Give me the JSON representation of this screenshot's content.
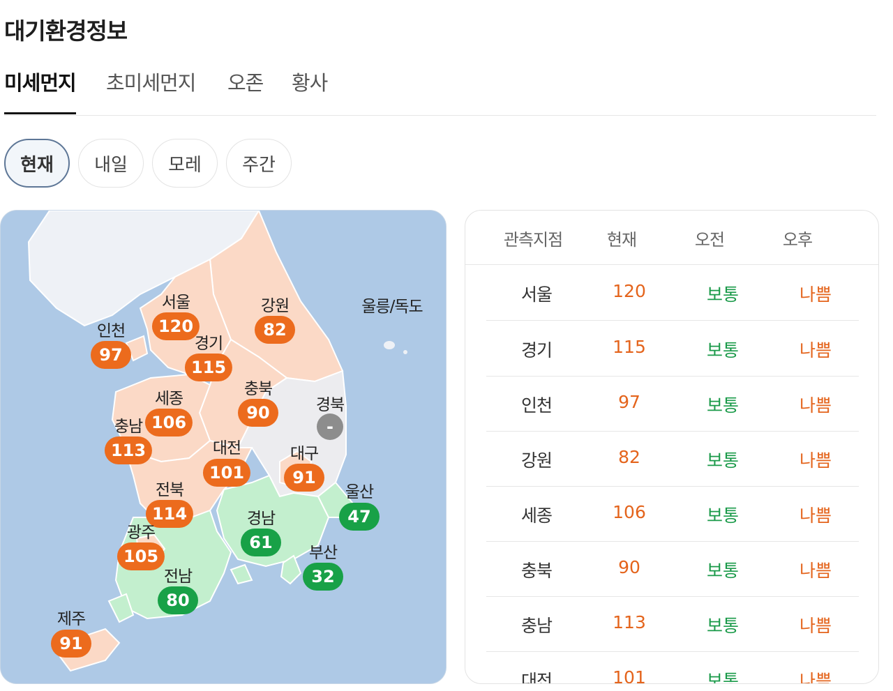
{
  "title": "대기환경정보",
  "tabs": [
    {
      "label": "미세먼지",
      "active": true
    },
    {
      "label": "초미세먼지",
      "active": false
    },
    {
      "label": "오존",
      "active": false
    },
    {
      "label": "황사",
      "active": false
    }
  ],
  "periods": [
    {
      "label": "현재",
      "active": true
    },
    {
      "label": "내일",
      "active": false
    },
    {
      "label": "모레",
      "active": false
    },
    {
      "label": "주간",
      "active": false
    }
  ],
  "colors": {
    "bad": "#ec6b1d",
    "normal": "#18a147",
    "no_data": "#8d8d8d",
    "sea": "#aec9e6",
    "bad_area": "#fbd9c6",
    "normal_area": "#c3efce",
    "no_data_area": "#ececef"
  },
  "map": {
    "regions": [
      {
        "name": "서울",
        "value": "120",
        "level": "bad"
      },
      {
        "name": "인천",
        "value": "97",
        "level": "bad"
      },
      {
        "name": "강원",
        "value": "82",
        "level": "bad"
      },
      {
        "name": "경기",
        "value": "115",
        "level": "bad"
      },
      {
        "name": "충북",
        "value": "90",
        "level": "bad"
      },
      {
        "name": "세종",
        "value": "106",
        "level": "bad"
      },
      {
        "name": "충남",
        "value": "113",
        "level": "bad"
      },
      {
        "name": "경북",
        "value": "-",
        "level": "none"
      },
      {
        "name": "대전",
        "value": "101",
        "level": "bad"
      },
      {
        "name": "대구",
        "value": "91",
        "level": "bad"
      },
      {
        "name": "울산",
        "value": "47",
        "level": "normal"
      },
      {
        "name": "전북",
        "value": "114",
        "level": "bad"
      },
      {
        "name": "경남",
        "value": "61",
        "level": "normal"
      },
      {
        "name": "광주",
        "value": "105",
        "level": "bad"
      },
      {
        "name": "부산",
        "value": "32",
        "level": "normal"
      },
      {
        "name": "전남",
        "value": "80",
        "level": "normal"
      },
      {
        "name": "제주",
        "value": "91",
        "level": "bad"
      },
      {
        "name": "울릉/독도",
        "value": "",
        "level": "none"
      }
    ]
  },
  "table": {
    "headers": [
      "관측지점",
      "현재",
      "오전",
      "오후"
    ],
    "rows": [
      {
        "name": "서울",
        "now": "120",
        "am": "보통",
        "pm": "나쁨"
      },
      {
        "name": "경기",
        "now": "115",
        "am": "보통",
        "pm": "나쁨"
      },
      {
        "name": "인천",
        "now": "97",
        "am": "보통",
        "pm": "나쁨"
      },
      {
        "name": "강원",
        "now": "82",
        "am": "보통",
        "pm": "나쁨"
      },
      {
        "name": "세종",
        "now": "106",
        "am": "보통",
        "pm": "나쁨"
      },
      {
        "name": "충북",
        "now": "90",
        "am": "보통",
        "pm": "나쁨"
      },
      {
        "name": "충남",
        "now": "113",
        "am": "보통",
        "pm": "나쁨"
      },
      {
        "name": "대전",
        "now": "101",
        "am": "보통",
        "pm": "나쁨"
      }
    ]
  }
}
